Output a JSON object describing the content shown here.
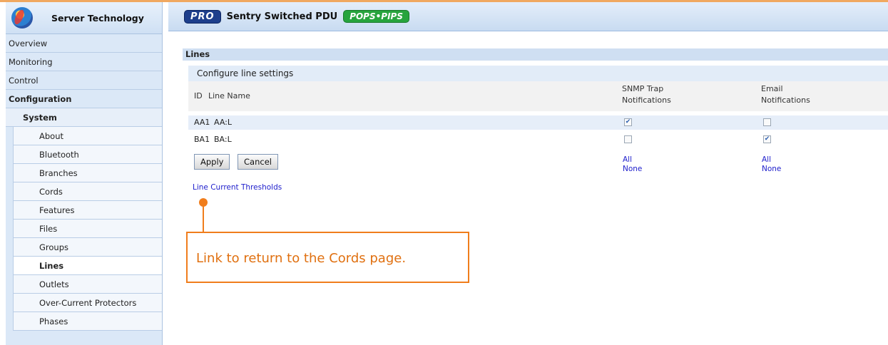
{
  "brand": {
    "name": "Server Technology"
  },
  "header": {
    "pro_badge": "PRO",
    "product": "Sentry Switched PDU",
    "pops_badge": "POPS•PIPS"
  },
  "sidebar": {
    "top": [
      "Overview",
      "Monitoring",
      "Control",
      "Configuration"
    ],
    "group": "System",
    "items": [
      "About",
      "Bluetooth",
      "Branches",
      "Cords",
      "Features",
      "Files",
      "Groups",
      "Lines",
      "Outlets",
      "Over-Current Protectors",
      "Phases"
    ],
    "active_item": "Lines"
  },
  "main": {
    "section_title": "Lines",
    "subsection_title": "Configure line settings",
    "columns": {
      "id": "ID",
      "name": "Line Name",
      "snmp": [
        "SNMP Trap",
        "Notifications"
      ],
      "email": [
        "Email",
        "Notifications"
      ]
    },
    "rows": [
      {
        "id": "AA1",
        "name": "AA:L",
        "snmp": true,
        "email": false
      },
      {
        "id": "BA1",
        "name": "BA:L",
        "snmp": false,
        "email": true
      }
    ],
    "apply_label": "Apply",
    "cancel_label": "Cancel",
    "all_label": "All",
    "none_label": "None",
    "threshold_link": "Line Current Thresholds"
  },
  "callout": {
    "text": "Link to return to the Cords page."
  },
  "colors": {
    "accent": "#f07d1c",
    "link": "#2020cc",
    "nav_bg": "#dbe8f7"
  }
}
